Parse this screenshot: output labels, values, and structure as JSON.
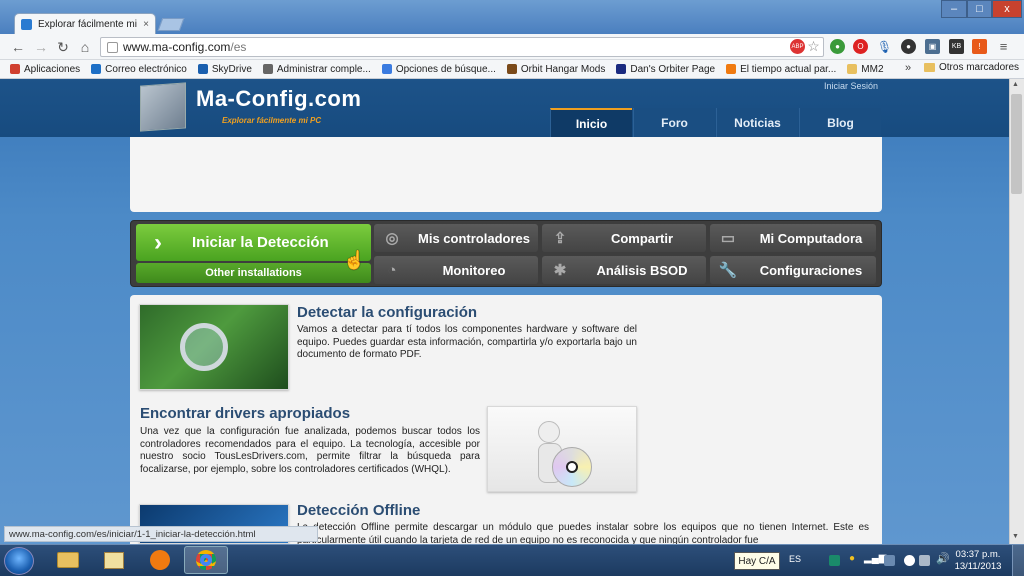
{
  "browser": {
    "tab_title": "Explorar fácilmente mi PC",
    "tab_close": "×",
    "url_host": "www.ma-config.com",
    "url_path": "/es",
    "window_controls": {
      "minimize": "–",
      "maximize": "□",
      "close": "x"
    },
    "bookmarks": [
      {
        "label": "Aplicaciones",
        "icon": "apps-icon",
        "color": "#d04030"
      },
      {
        "label": "Correo electrónico",
        "icon": "outlook-icon",
        "color": "#1d6fc6"
      },
      {
        "label": "SkyDrive",
        "icon": "skydrive-icon",
        "color": "#1a5fae"
      },
      {
        "label": "Administrar comple...",
        "icon": "puzzle-icon",
        "color": "#666666"
      },
      {
        "label": "Opciones de búsque...",
        "icon": "google-icon",
        "color": "#3a7be0"
      },
      {
        "label": "Orbit Hangar Mods",
        "icon": "orbit-icon",
        "color": "#7a4a1a"
      },
      {
        "label": "Dan's Orbiter Page",
        "icon": "dan-icon",
        "color": "#1a2a80"
      },
      {
        "label": "El tiempo actual par...",
        "icon": "weather-icon",
        "color": "#f07a10"
      },
      {
        "label": "MM2",
        "icon": "folder-icon",
        "color": "#e8c060"
      }
    ],
    "bookmarks_more": "»",
    "other_bookmarks": "Otros marcadores",
    "status_url": "www.ma-config.com/es/iniciar/1-1_iniciar-la-detección.html"
  },
  "site": {
    "title": "Ma-Config.com",
    "tagline": "Explorar fácilmente mi PC",
    "login": "Iniciar Sesión",
    "nav": [
      {
        "label": "Inicio",
        "active": true
      },
      {
        "label": "Foro",
        "active": false
      },
      {
        "label": "Noticias",
        "active": false
      },
      {
        "label": "Blog",
        "active": false
      }
    ],
    "menu": {
      "start_label": "Iniciar la Detección",
      "start_arrow": "›",
      "other_label": "Other installations",
      "buttons": [
        {
          "label": "Mis controladores",
          "icon": "compass-icon"
        },
        {
          "label": "Compartir",
          "icon": "share-icon"
        },
        {
          "label": "Mi Computadora",
          "icon": "monitor-icon"
        },
        {
          "label": "Monitoreo",
          "icon": "gauge-icon"
        },
        {
          "label": "Análisis BSOD",
          "icon": "bug-icon"
        },
        {
          "label": "Configuraciones",
          "icon": "wrench-icon"
        }
      ]
    },
    "sections": [
      {
        "title": "Detectar la configuración",
        "text": "Vamos a detectar para tí todos los componentes hardware y software del equipo. Puedes guardar esta información, compartirla y/o exportarla bajo un documento de formato PDF."
      },
      {
        "title": "Encontrar drivers apropiados",
        "text": "Una vez que la configuración fue analizada, podemos buscar todos los controladores recomendados para el equipo. La tecnología, accesible por nuestro socio TousLesDrivers.com, permite filtrar la búsqueda para focalizarse, por ejemplo, sobre los controladores certificados (WHQL)."
      },
      {
        "title": "Detección Offline",
        "text": "La detección Offline permite descargar un módulo que puedes instalar sobre los equipos que no tienen Internet. Este es particularmente útil cuando la tarjeta de red de un equipo no es reconocida y que ningún controlador fue"
      }
    ]
  },
  "taskbar": {
    "lang_tooltip": "Hay C/A",
    "lang": "ES",
    "time": "03:37 p.m.",
    "date": "13/11/2013"
  }
}
